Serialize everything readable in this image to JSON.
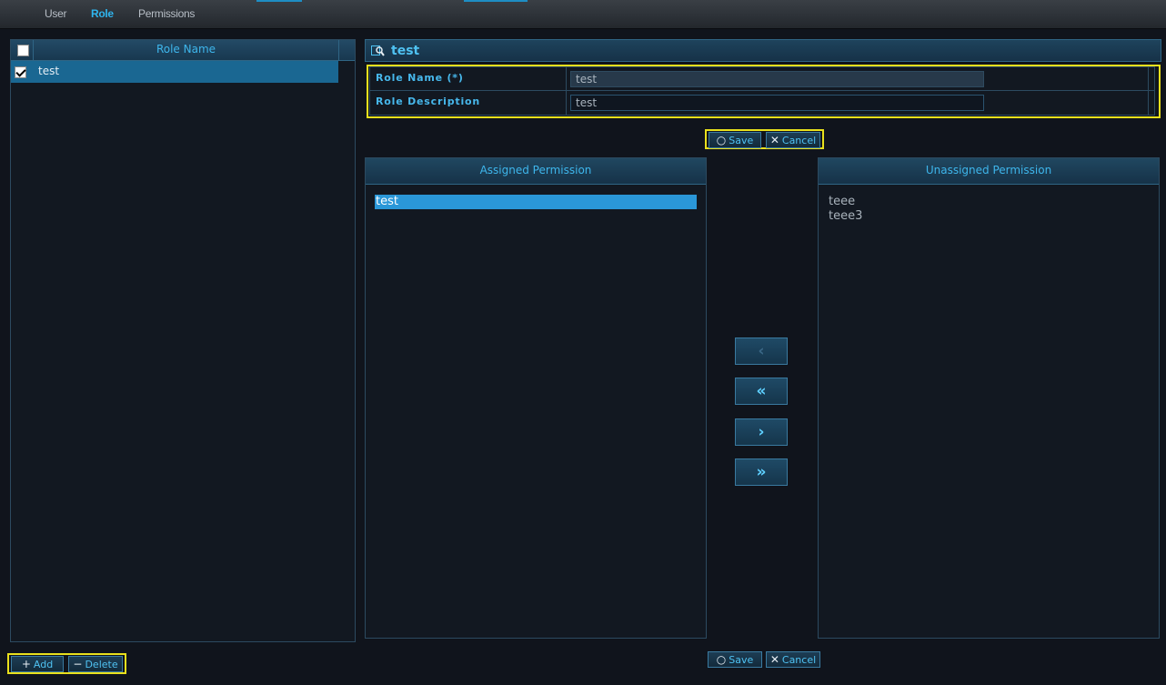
{
  "tabs": [
    {
      "label": "User",
      "active": false
    },
    {
      "label": "Role",
      "active": true
    },
    {
      "label": "Permissions",
      "active": false
    }
  ],
  "role_list": {
    "header": "Role Name",
    "rows": [
      {
        "label": "test",
        "checked": true,
        "selected": true
      }
    ],
    "add_label": "Add",
    "delete_label": "Delete"
  },
  "detail": {
    "title": "test",
    "role_name_label": "Role Name (*)",
    "role_name_value": "test",
    "role_description_label": "Role Description",
    "role_description_value": "test",
    "save_label": "Save",
    "cancel_label": "Cancel"
  },
  "assigned": {
    "header": "Assigned Permission",
    "items": [
      "test"
    ]
  },
  "unassigned": {
    "header": "Unassigned Permission",
    "items": [
      "teee",
      "teee3"
    ]
  },
  "move_buttons": [
    "‹",
    "«",
    "›",
    "»"
  ],
  "icons": {
    "add": "plus-icon",
    "delete": "minus-icon",
    "save": "circle-icon",
    "cancel": "x-icon",
    "search": "magnifier-icon"
  },
  "colors": {
    "accent": "#3eb6ec",
    "selection": "#2a97d8",
    "row_selected": "#1a6792",
    "highlight_box": "#e9e01c"
  }
}
